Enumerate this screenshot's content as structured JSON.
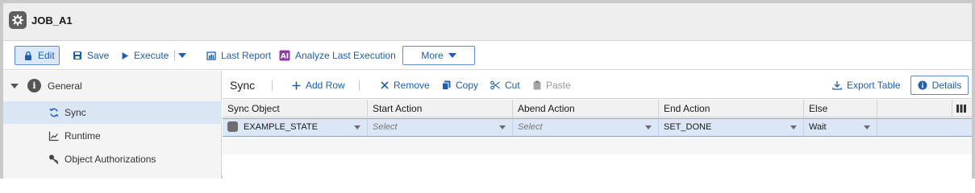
{
  "window": {
    "title": "JOB_A1",
    "icon": "gear-icon"
  },
  "toolbar": {
    "edit_label": "Edit",
    "save_label": "Save",
    "execute_label": "Execute",
    "last_report_label": "Last Report",
    "analyze_label": "Analyze Last Execution",
    "more_label": "More"
  },
  "tree": {
    "general": "General",
    "items": [
      {
        "label": "Sync",
        "icon": "sync-icon",
        "selected": true
      },
      {
        "label": "Runtime",
        "icon": "runtime-chart-icon"
      },
      {
        "label": "Object Authorizations",
        "icon": "key-icon"
      }
    ]
  },
  "panel": {
    "title": "Sync",
    "add_row": "Add Row",
    "remove": "Remove",
    "copy": "Copy",
    "cut": "Cut",
    "paste": "Paste",
    "export_table": "Export Table",
    "details": "Details"
  },
  "grid": {
    "columns": [
      "Sync Object",
      "Start Action",
      "Abend Action",
      "End Action",
      "Else"
    ],
    "rows": [
      {
        "sync_object": "EXAMPLE_STATE",
        "start_action": "Select",
        "abend_action": "Select",
        "end_action": "SET_DONE",
        "else": "Wait"
      }
    ]
  },
  "colors": {
    "accent": "#1f5fae",
    "selection": "#dbe7f7",
    "titlebar": "#eeeeee"
  }
}
